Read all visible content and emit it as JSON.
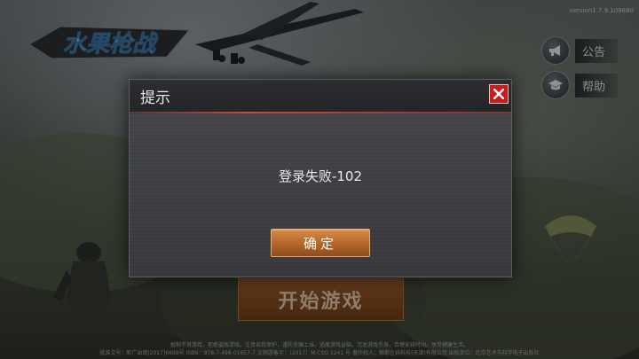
{
  "version": "version1.7.9.109880",
  "logo_text": "水果枪战",
  "side_buttons": [
    {
      "label": "公告",
      "icon": "megaphone-icon"
    },
    {
      "label": "帮助",
      "icon": "graduation-cap-icon"
    }
  ],
  "start_button": {
    "label": "开始游戏"
  },
  "footer": {
    "line1": "抵制不良游戏，拒绝盗版游戏。注意自我保护，谨防受骗上当。适度游戏益脑，沉迷游戏伤身。合理安排时间，享受健康生活。",
    "line2": "批准文号：新广出审[2017]6698号    ISBN：978-7-498-01657-7    文网游备字：〔2017〕M-CSG 1241 号    著作权人：鲸歌在线科技(天津)有限公司    出版单位：北京艺术与科学电子出版社"
  },
  "dialog": {
    "title": "提示",
    "message": "登录失败-102",
    "confirm_label": "确定"
  },
  "colors": {
    "dialog_bg": "#3b3c40",
    "close_red": "#c51d1d",
    "confirm_orange": "#c4742f"
  }
}
